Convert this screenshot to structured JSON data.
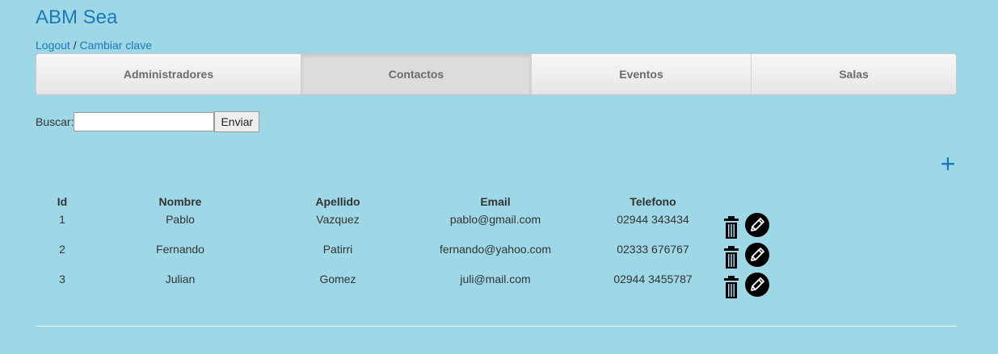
{
  "app": {
    "title": "ABM Sea"
  },
  "header": {
    "logout": "Logout",
    "separator": " / ",
    "change_password": "Cambiar clave"
  },
  "tabs": [
    {
      "label": "Administradores",
      "active": false
    },
    {
      "label": "Contactos",
      "active": true
    },
    {
      "label": "Eventos",
      "active": false
    },
    {
      "label": "Salas",
      "active": false
    }
  ],
  "search": {
    "label": "Buscar:",
    "value": "",
    "button": "Enviar"
  },
  "add_icon": "+",
  "table": {
    "headers": {
      "id": "Id",
      "nombre": "Nombre",
      "apellido": "Apellido",
      "email": "Email",
      "telefono": "Telefono"
    },
    "rows": [
      {
        "id": "1",
        "nombre": "Pablo",
        "apellido": "Vazquez",
        "email": "pablo@gmail.com",
        "telefono": "02944 343434"
      },
      {
        "id": "2",
        "nombre": "Fernando",
        "apellido": "Patirri",
        "email": "fernando@yahoo.com",
        "telefono": "02333 676767"
      },
      {
        "id": "3",
        "nombre": "Julian",
        "apellido": "Gomez",
        "email": "juli@mail.com",
        "telefono": "02944 3455787"
      }
    ],
    "row_icons": [
      "trash-icon",
      "edit-icon"
    ]
  },
  "colors": {
    "background": "#9ed8e6",
    "accent": "#1a7ab8"
  }
}
